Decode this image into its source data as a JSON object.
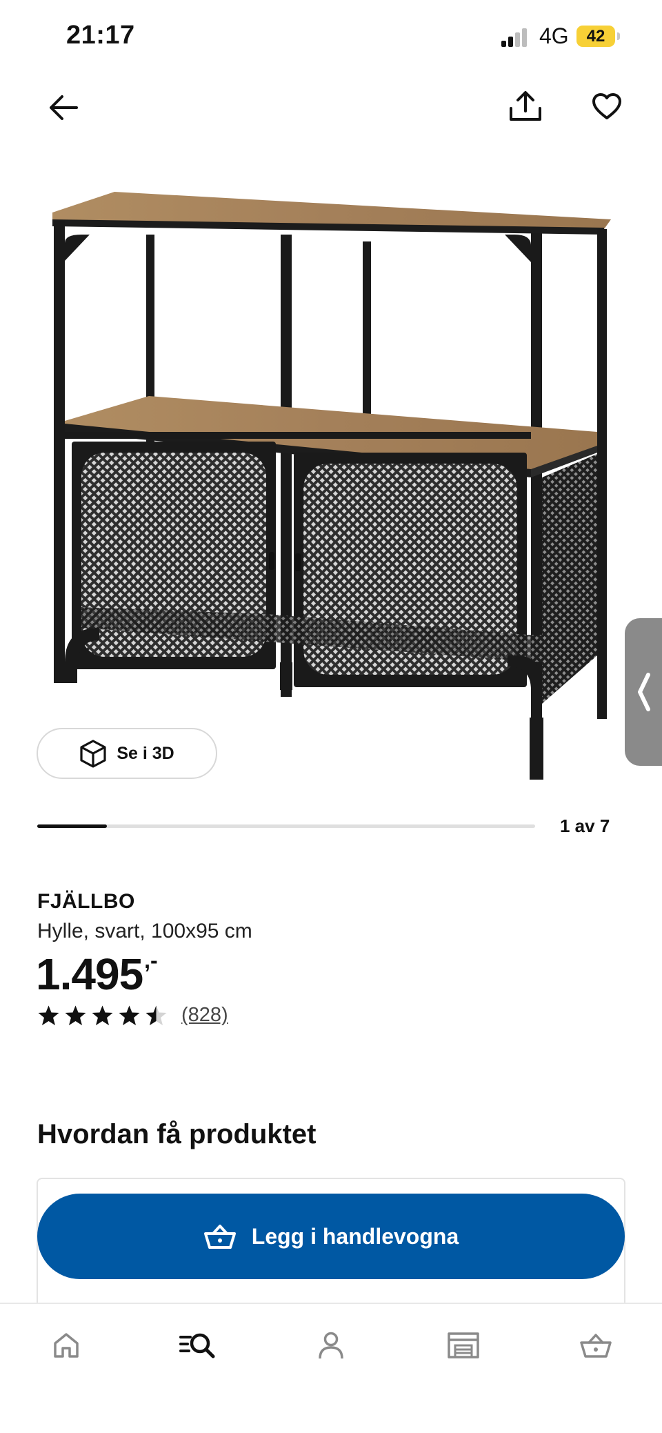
{
  "status_bar": {
    "time": "21:17",
    "network": "4G",
    "battery": "42"
  },
  "top_bar": {
    "back_icon": "arrow-left-icon",
    "share_icon": "share-icon",
    "favorite_icon": "heart-icon"
  },
  "gallery": {
    "view_3d_label": "Se i 3D",
    "counter": "1 av 7",
    "current": 1,
    "total": 7,
    "progress_fraction": 0.14
  },
  "product": {
    "name": "FJÄLLBO",
    "description": "Hylle, svart, 100x95 cm",
    "price": "1.495",
    "price_suffix": ",-",
    "rating": 4.5,
    "rating_max": 5,
    "review_count": "(828)"
  },
  "delivery": {
    "section_title": "Hvordan få produktet",
    "add_to_cart_label": "Legg i handlevogna"
  },
  "bottom_nav": {
    "items": [
      "home-icon",
      "search-list-icon",
      "profile-icon",
      "store-icon",
      "cart-icon"
    ],
    "active": "search-list-icon"
  },
  "colors": {
    "primary_blue": "#0058a3",
    "battery_yellow": "#f7d036",
    "text_dark": "#111111",
    "side_tab_gray": "#8a8a8a"
  }
}
